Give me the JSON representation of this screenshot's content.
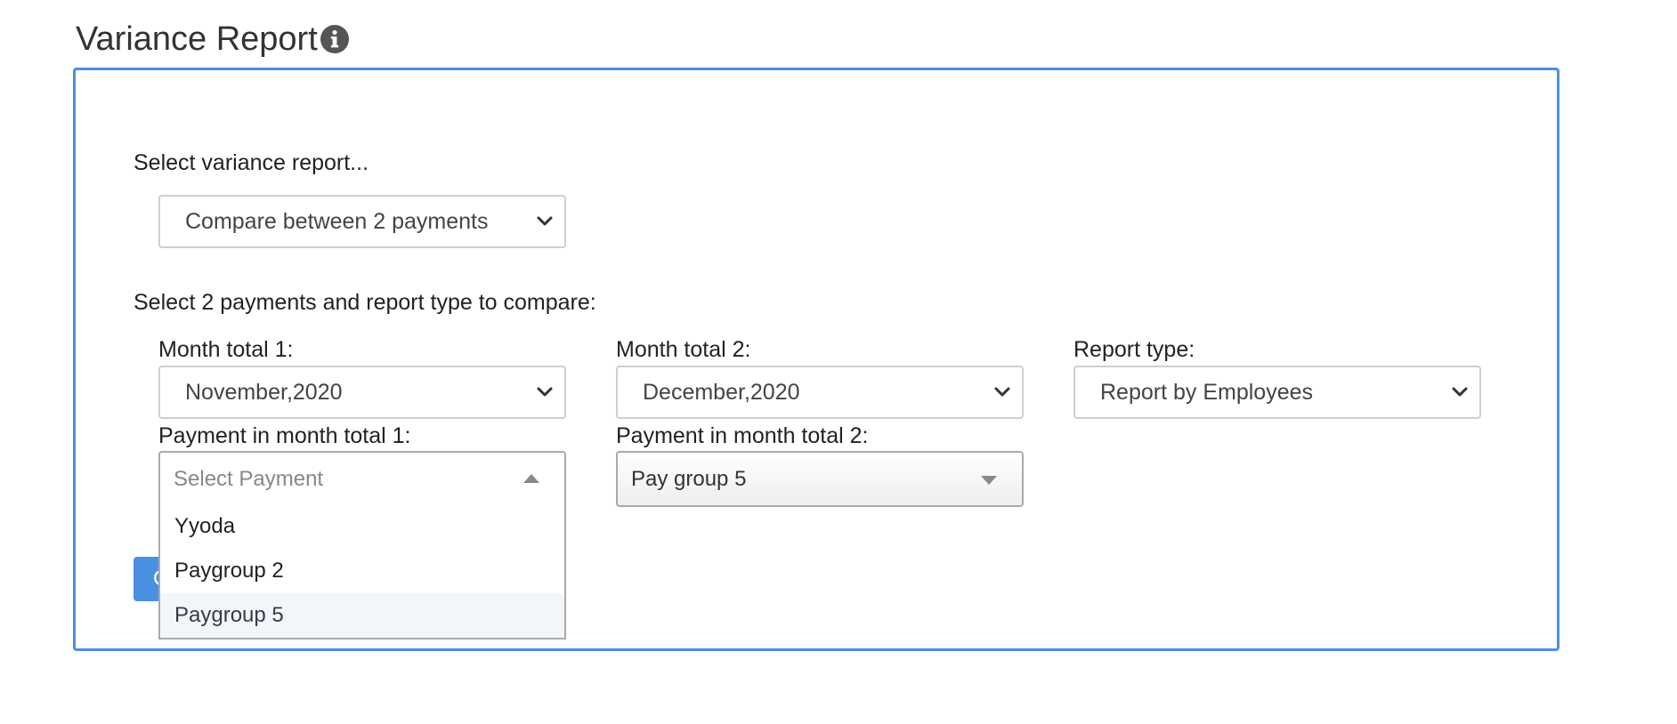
{
  "page": {
    "title": "Variance Report",
    "info_icon": "info-circle-icon"
  },
  "panel": {
    "report_select_label": "Select variance report...",
    "report_select_value": "Compare between 2 payments",
    "compare_instructions": "Select 2 payments and report type to compare:",
    "month1": {
      "label": "Month total 1:",
      "value": "November,2020"
    },
    "month2": {
      "label": "Month total 2:",
      "value": "December,2020"
    },
    "report_type": {
      "label": "Report type:",
      "value": "Report by Employees"
    },
    "payment1": {
      "label": "Payment in month total 1:",
      "placeholder": "Select Payment",
      "options": [
        "Yyoda",
        "Paygroup 2",
        "Paygroup 5"
      ],
      "highlighted_option": "Paygroup 5"
    },
    "payment2": {
      "label": "Payment in month total 2:",
      "value": "Pay group 5"
    },
    "action_button_label": "C"
  },
  "colors": {
    "accent": "#4a90e2",
    "border": "#cfcfcf",
    "highlight": "#f3f6f9"
  }
}
